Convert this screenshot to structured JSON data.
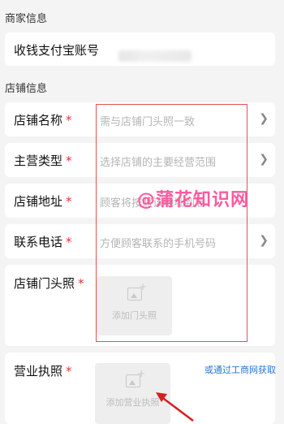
{
  "sections": {
    "merchant": "商家信息",
    "store": "店铺信息"
  },
  "alipay": {
    "label": "收钱支付宝账号"
  },
  "fields": [
    {
      "label": "店铺名称",
      "placeholder": "需与店铺门头照一致"
    },
    {
      "label": "主营类型",
      "placeholder": "选择店铺的主要经营范围"
    },
    {
      "label": "店铺地址",
      "placeholder": "顾客将按照该地址到店"
    },
    {
      "label": "联系电话",
      "placeholder": "方便顾客联系的手机号码"
    }
  ],
  "required_mark": "*",
  "storefront": {
    "label": "店铺门头照",
    "upload_caption": "添加门头照"
  },
  "license": {
    "label": "营业执照",
    "upload_caption": "添加营业执照",
    "alt_link": "或通过工商网获取"
  },
  "watermark": "@蒲花知识网",
  "colors": {
    "required": "#e23636",
    "link": "#2a73d9",
    "annotation": "#e05252",
    "watermark": "#ff5aa0"
  }
}
